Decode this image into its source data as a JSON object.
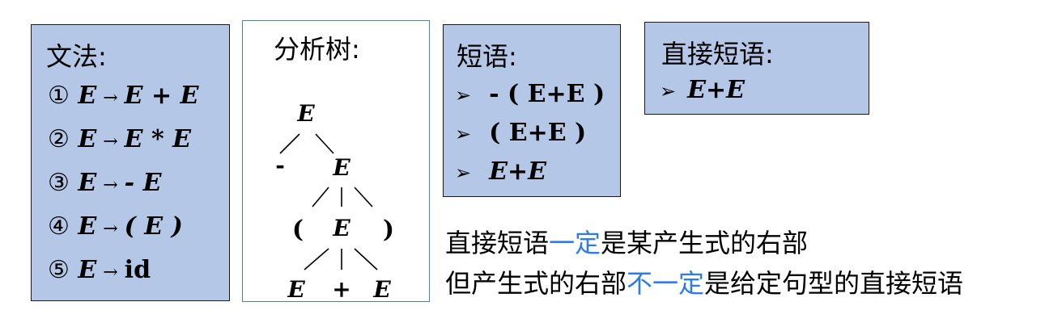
{
  "grammar": {
    "title": "文法:",
    "rules": [
      {
        "num": "①",
        "lhs": "E",
        "arrow": "→",
        "rhs": "E + E"
      },
      {
        "num": "②",
        "lhs": "E",
        "arrow": "→",
        "rhs": "E * E"
      },
      {
        "num": "③",
        "lhs": "E",
        "arrow": "→",
        "rhs": "- E"
      },
      {
        "num": "④",
        "lhs": "E",
        "arrow": "→",
        "rhs": "( E )"
      },
      {
        "num": "⑤",
        "lhs": "E",
        "arrow": "→",
        "rhs": "id"
      }
    ]
  },
  "tree": {
    "title": "分析树:",
    "nodes": {
      "root": "E",
      "minus": "-",
      "e1": "E",
      "lparen": "(",
      "e2": "E",
      "rparen": ")",
      "e3": "E",
      "plus": "+",
      "e4": "E"
    }
  },
  "phrases": {
    "title": "短语:",
    "bullet": "➢",
    "items": [
      "- ( E+E )",
      "( E+E )",
      "E+E"
    ]
  },
  "direct_phrase": {
    "title": "直接短语:",
    "bullet": "➢",
    "item": "E+E"
  },
  "notes": {
    "line1": {
      "a": "直接短语",
      "b": "一定",
      "c": "是某产生式的右部"
    },
    "line2": {
      "a": "但产生式的右部",
      "b": "不一定",
      "c": "是给定句型的直接短语"
    }
  },
  "colors": {
    "box_fill": "#b4c7e7",
    "tree_border": "#4a80b8",
    "highlight": "#2f7bea"
  }
}
